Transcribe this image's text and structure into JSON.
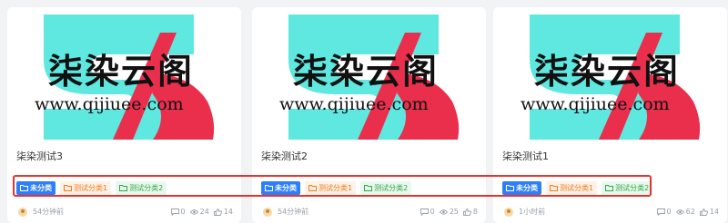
{
  "colors": {
    "logo_cyan": "#5ee8e0",
    "logo_red": "#ea2f4d",
    "tag_blue": "#2d7ff9",
    "tag_orange": "#f07a19",
    "tag_green": "#2fa64b",
    "highlight": "#e8322f"
  },
  "cards": [
    {
      "thumbnail": {
        "brand_cn": "柒染云阁",
        "brand_url": "www.qijiuee.com"
      },
      "title": "柒染测试3",
      "tags": [
        "未分类",
        "测试分类1",
        "测试分类2"
      ],
      "time": "54分钟前",
      "comments": "0",
      "views": "24",
      "likes": "14"
    },
    {
      "thumbnail": {
        "brand_cn": "柒染云阁",
        "brand_url": "www.qijiuee.com"
      },
      "title": "柒染测试2",
      "tags": [
        "未分类",
        "测试分类1",
        "测试分类2"
      ],
      "time": "54分钟前",
      "comments": "0",
      "views": "25",
      "likes": "8"
    },
    {
      "thumbnail": {
        "brand_cn": "柒染云阁",
        "brand_url": "www.qijiuee.com"
      },
      "title": "柒染测试1",
      "tags": [
        "未分类",
        "测试分类1",
        "测试分类2"
      ],
      "time": "1小时前",
      "comments": "0",
      "views": "62",
      "likes": "14"
    }
  ]
}
